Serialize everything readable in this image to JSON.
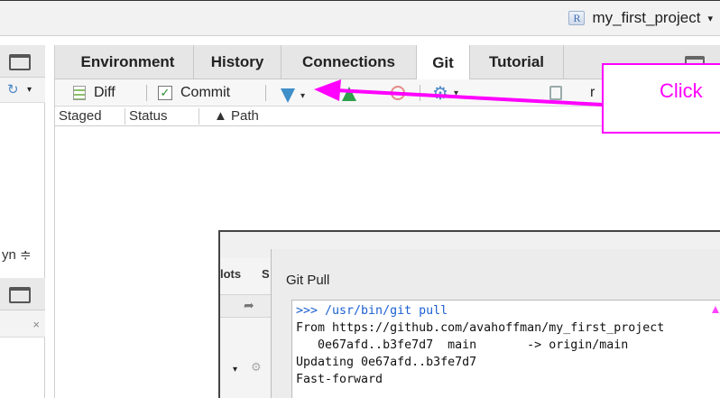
{
  "project": {
    "name": "my_first_project",
    "logo_letter": "R",
    "caret": "▾"
  },
  "left_pane": {
    "sort_label": "yn ≑",
    "close_glyph": "×"
  },
  "tabs": [
    {
      "label": "Environment"
    },
    {
      "label": "History"
    },
    {
      "label": "Connections"
    },
    {
      "label": "Git"
    },
    {
      "label": "Tutorial"
    }
  ],
  "active_tab": "Git",
  "git_toolbar": {
    "diff_label": "Diff",
    "commit_label": "Commit",
    "commit_check": "✓",
    "more_label": "r"
  },
  "columns": {
    "staged": "Staged",
    "status": "Status",
    "path": "▲ Path"
  },
  "callout": {
    "text": "Click",
    "color": "#ff00ff"
  },
  "bg_window": {
    "tab1": "lots",
    "tab2": "S"
  },
  "dialog": {
    "title": "Git Pull",
    "lines": [
      ">>> /usr/bin/git pull",
      "From https://github.com/avahoffman/my_first_project",
      "   0e67afd..b3fe7d7  main       -> origin/main",
      "Updating 0e67afd..b3fe7d7",
      "Fast-forward"
    ]
  },
  "colors": {
    "pull_arrow": "#3f8fc9",
    "push_arrow": "#2ea14a",
    "annotation": "#ff00ff"
  }
}
